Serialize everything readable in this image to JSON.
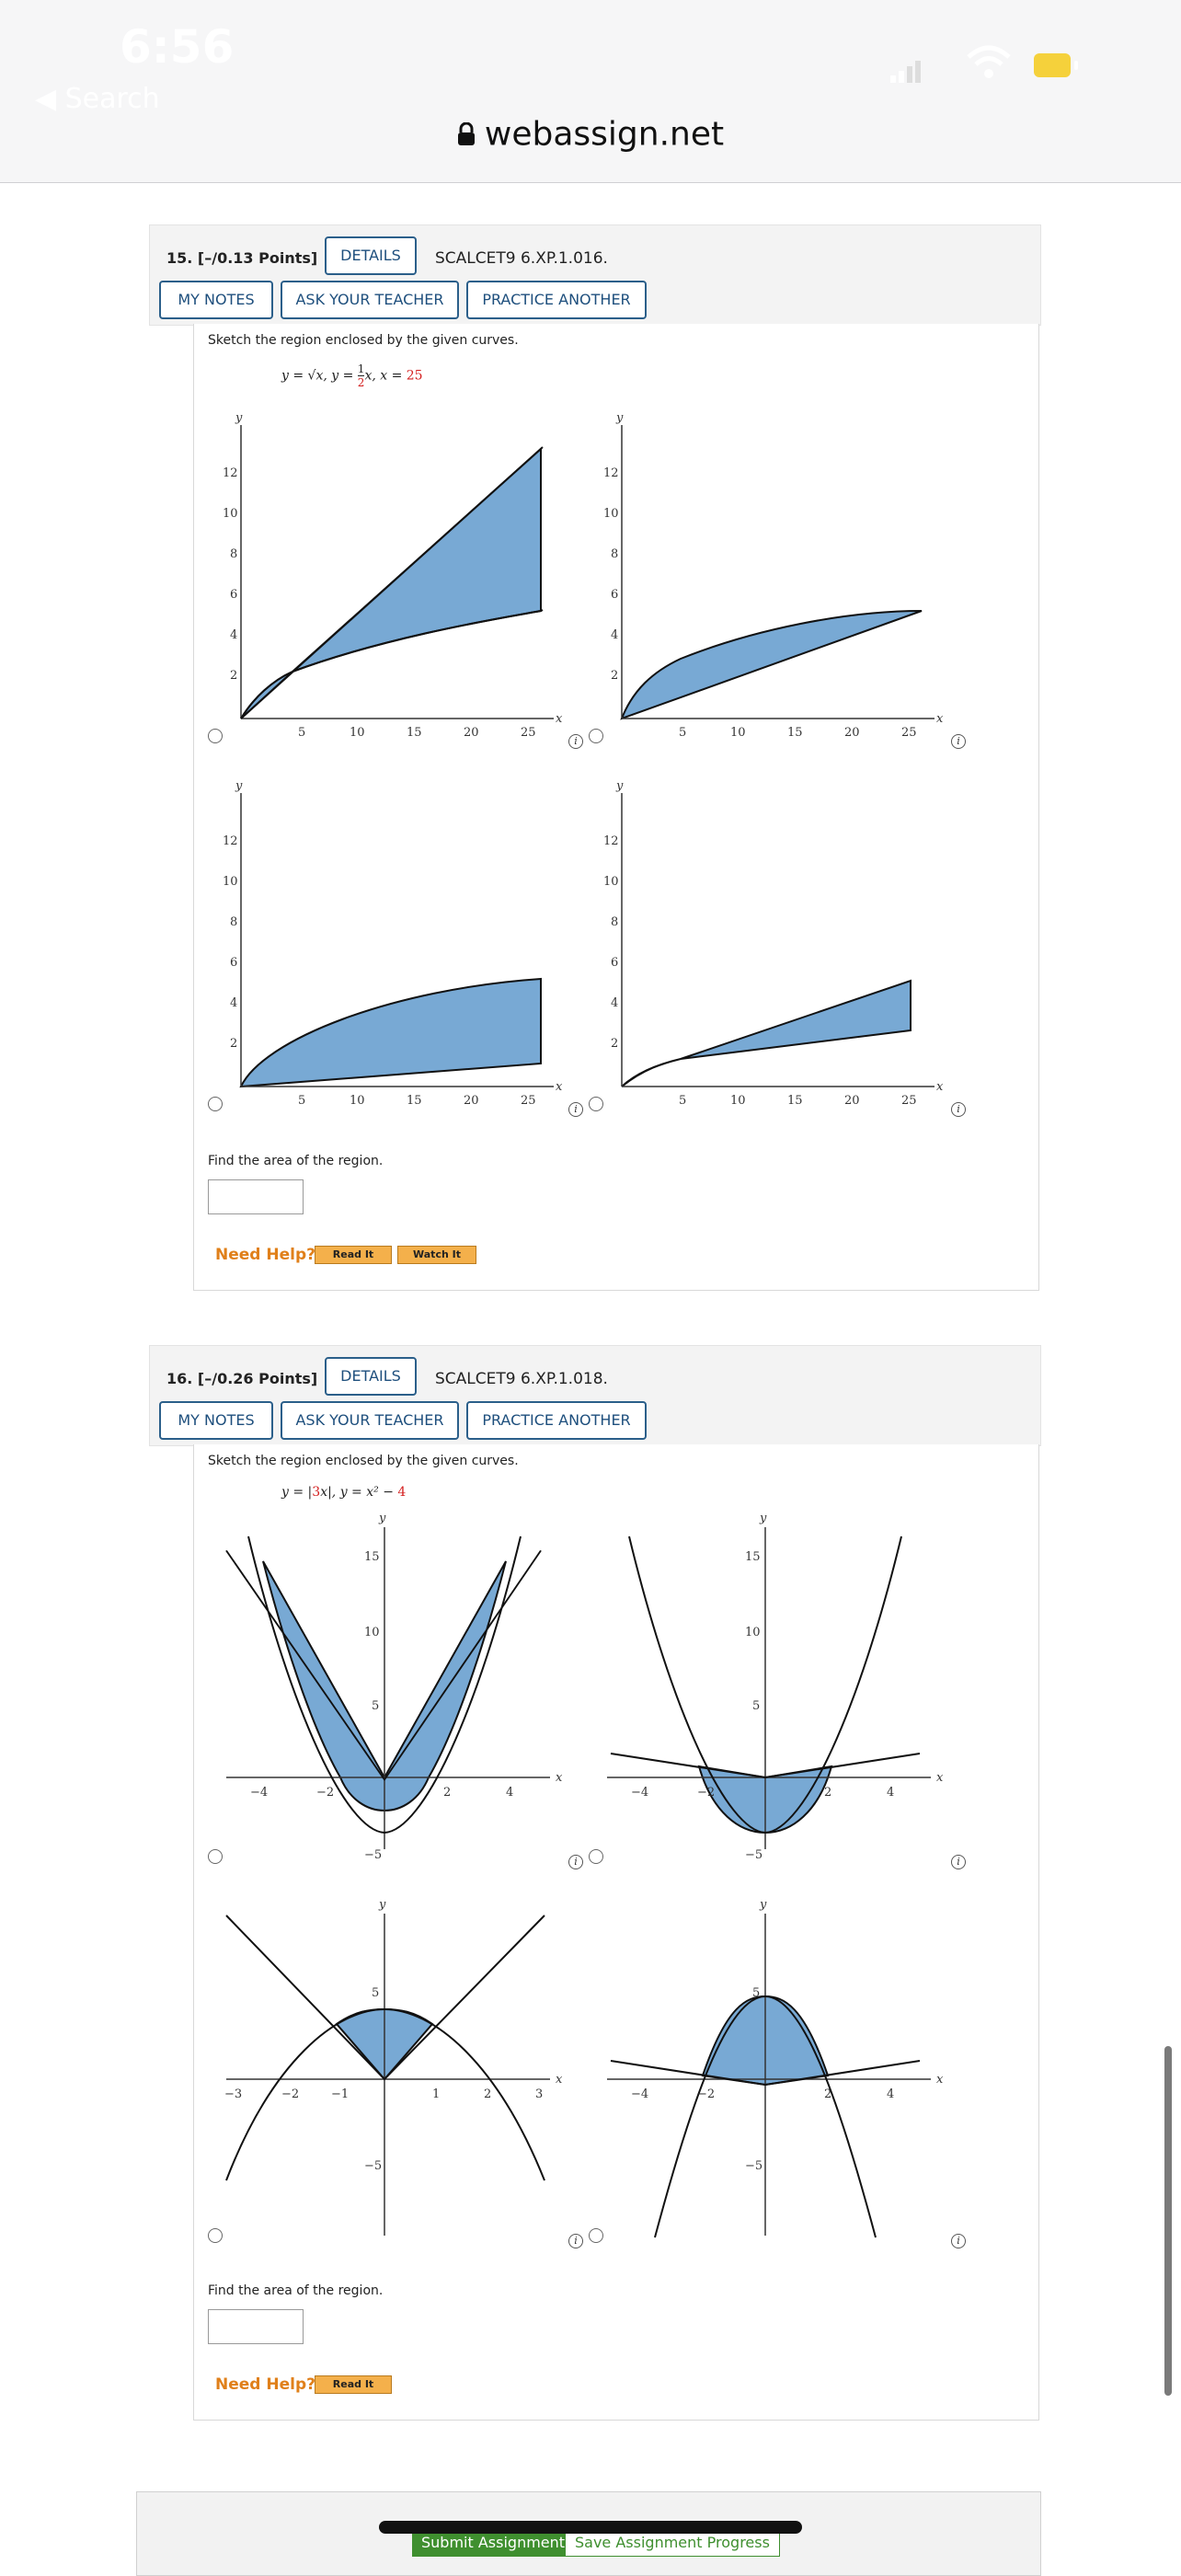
{
  "status_bar": {
    "time": "6:56",
    "back_label": "◀ Search"
  },
  "browser": {
    "url": "webassign.net"
  },
  "questions": [
    {
      "number_points": "15.  [–/0.13 Points]",
      "details_label": "DETAILS",
      "code": "SCALCET9 6.XP.1.016.",
      "my_notes_label": "MY NOTES",
      "ask_teacher_label": "ASK YOUR TEACHER",
      "practice_label": "PRACTICE ANOTHER",
      "prompt": "Sketch the region enclosed by the given curves.",
      "equation": {
        "part1": "y = √x,   y = ",
        "frac_num": "1",
        "frac_den": "2",
        "part2": "x,   x = ",
        "value": "25"
      },
      "find_text": "Find the area of the region.",
      "need_help": "Need Help?",
      "help_buttons": [
        "Read It",
        "Watch It"
      ]
    },
    {
      "number_points": "16.  [–/0.26 Points]",
      "details_label": "DETAILS",
      "code": "SCALCET9 6.XP.1.018.",
      "my_notes_label": "MY NOTES",
      "ask_teacher_label": "ASK YOUR TEACHER",
      "practice_label": "PRACTICE ANOTHER",
      "prompt": "Sketch the region enclosed by the given curves.",
      "equation": {
        "part1": "y = |",
        "coef": "3",
        "part2": "x|,    y = x² − ",
        "value": "4"
      },
      "find_text": "Find the area of the region.",
      "need_help": "Need Help?",
      "help_buttons": [
        "Read It"
      ]
    }
  ],
  "graphs_q15": {
    "x_label": "x",
    "y_label": "y",
    "x_ticks": [
      "5",
      "10",
      "15",
      "20",
      "25"
    ],
    "y_ticks": [
      "2",
      "4",
      "6",
      "8",
      "10",
      "12"
    ]
  },
  "graphs_q16": {
    "x_label": "x",
    "y_label": "y",
    "a": {
      "x_ticks": [
        "−4",
        "−2",
        "2",
        "4"
      ],
      "y_ticks": [
        "15",
        "10",
        "5",
        "−5"
      ]
    },
    "b": {
      "x_ticks": [
        "−4",
        "−2",
        "2",
        "4"
      ],
      "y_ticks": [
        "15",
        "10",
        "5",
        "−5"
      ]
    },
    "c": {
      "x_ticks": [
        "−3",
        "−2",
        "−1",
        "1",
        "2",
        "3"
      ],
      "y_ticks": [
        "5",
        "−5"
      ]
    },
    "d": {
      "x_ticks": [
        "−4",
        "−2",
        "2",
        "4"
      ],
      "y_ticks": [
        "5",
        "−5"
      ]
    }
  },
  "footer": {
    "submit_label": "Submit Assignment",
    "save_label": "Save Assignment Progress"
  },
  "colors": {
    "region_fill": "#78a9d4",
    "button_border": "#2b5f8a",
    "help_orange": "#e0801a",
    "submit_green": "#3f8f2f"
  }
}
